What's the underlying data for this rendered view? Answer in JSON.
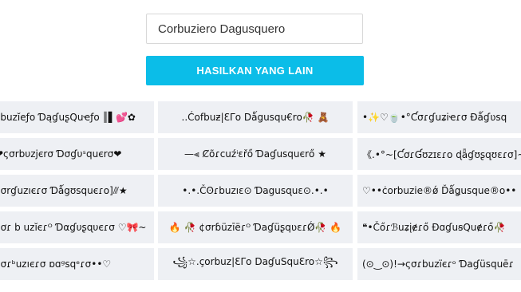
{
  "input": {
    "value": "Corbuziero Dagusquero"
  },
  "button": {
    "label": "HASILKAN YANG LAIN"
  },
  "results": [
    [
      "ɾbuzĭeƒo ƊąɠuʂQuҽƒo ║▌💕✿",
      "..Ćofbuƶ|ƐΓo Dǻgusqu€ro🥀 🧸",
      "•✨♡🍵•°Ƈσɾɠuʑiҽɾσ Ɖǻɠʋsq"
    ],
    [
      "❤ςσrbυzjєrσ Ɗσɠυˢquєrσ❤",
      "—⫷ Ȼõɾcuźⁱɛřő Ɗaɠusquєrő ★",
      "《.•°~[ƇơɾƓʊzɪɛɾo ɖǟɠʊʂզʊɛɾσ]~"
    ],
    [
      "ɕσrɠuzıєɾσ Ɗǻgʊsquєɾo]⫻★",
      "•.•.Čʘɾbuzıɛ⊙ Ɗagusɋuɛ⊙.•.•",
      "♡••ċorbuzie®ǿ Ďǻǥusque®o••"
    ],
    [
      "ćơɾ b uzĭєɾᴼ Ɗαɠυʂɋυєɾσ ♡🎀~",
      "🔥 🥀 ¢σrɓüzīëɾᴼ ƊaɠüʂqʋɛɾǾ🥀 🔥",
      "❝•Čőɾℬuʑįɇɾő ƉɑɠuꞩQuɇɾő🥀"
    ],
    [
      "ɕσɾᵇuzıєɾσ ɒɑᵍsqᵉɾσ••♡",
      "꧁☆.çorbuz|ƐΓo DaɠuSquƐro☆꧂",
      "(⊙‿⊙)!→ςσɾbuzïєɾᵒ Ɗaɠüsquēɾ"
    ]
  ]
}
